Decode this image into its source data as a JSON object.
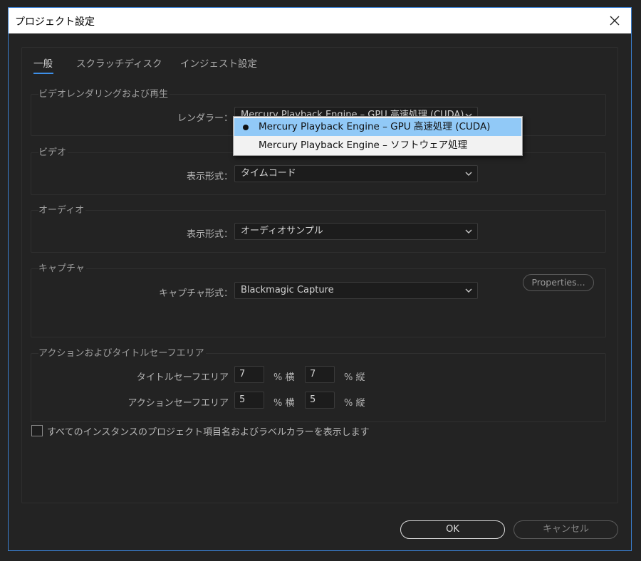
{
  "window": {
    "title": "プロジェクト設定"
  },
  "tabs": [
    {
      "label": "一般",
      "active": true
    },
    {
      "label": "スクラッチディスク",
      "active": false
    },
    {
      "label": "インジェスト設定",
      "active": false
    }
  ],
  "render_group": {
    "title": "ビデオレンダリングおよび再生",
    "renderer_label": "レンダラー：",
    "renderer_value": "Mercury Playback Engine – GPU 高速処理 (CUDA)"
  },
  "renderer_dropdown": {
    "options": [
      {
        "label": "Mercury Playback Engine – GPU 高速処理 (CUDA)",
        "selected": true
      },
      {
        "label": "Mercury Playback Engine – ソフトウェア処理",
        "selected": false
      }
    ]
  },
  "video_group": {
    "title": "ビデオ",
    "display_format_label": "表示形式：",
    "display_format_value": "タイムコード"
  },
  "audio_group": {
    "title": "オーディオ",
    "display_format_label": "表示形式：",
    "display_format_value": "オーディオサンプル"
  },
  "capture_group": {
    "title": "キャプチャ",
    "capture_format_label": "キャプチャ形式：",
    "capture_format_value": "Blackmagic Capture",
    "properties_button": "Properties..."
  },
  "safe_area_group": {
    "title": "アクションおよびタイトルセーフエリア",
    "title_safe_label": "タイトルセーフエリア",
    "title_safe_h": "7",
    "title_safe_v": "7",
    "action_safe_label": "アクションセーフエリア",
    "action_safe_h": "5",
    "action_safe_v": "5",
    "unit_h": "% 横",
    "unit_v": "% 縦"
  },
  "show_label_colors": {
    "label": "すべてのインスタンスのプロジェクト項目名およびラベルカラーを表示します",
    "checked": false
  },
  "footer": {
    "ok_label": "OK",
    "cancel_label": "キャンセル"
  },
  "colors": {
    "accent": "#3d8fe8",
    "selected_option": "#91c9f7",
    "dialog_bg": "#232323"
  },
  "icons": [
    "close-icon",
    "chevron-down-icon",
    "bullet-icon",
    "checkbox-icon"
  ]
}
